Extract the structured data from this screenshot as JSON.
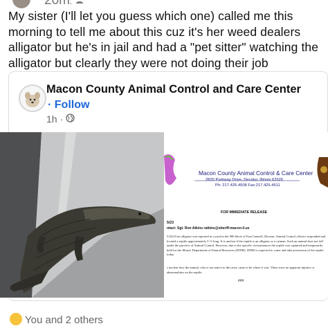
{
  "top_bar": {
    "time": "20m",
    "dot": "·",
    "audience_icon": "friends-icon"
  },
  "post": {
    "text": "My sister (I'll let you guess which one) called me this morning to tell me about this cuz it's her weed dealers alligator but he's in jail and had a \"pet sitter\" watching the alligator but clearly they were not doing their job"
  },
  "shared": {
    "org_name": "Macon County Animal Control and Care Center",
    "follow_label": "Follow",
    "follow_dot": "·",
    "time": "1h",
    "time_dot": "·",
    "audience_icon": "globe-icon"
  },
  "document": {
    "header": "Macon County Animal Control & Care Center",
    "address": "2820 Parkway Drive, Decatur, Illinois 62526",
    "phone": "Ph: 217.425.4508 Fax:217.425.4511",
    "release": "FOR IMMEDIATE RELEASE",
    "date": "5/23",
    "contact": "ntact: Sgt. Ron Atkins ratkins@sheriff-macon-il.us",
    "paragraph1": "5/24/23 an alligator was reported in a yard in the 900 block of East Cantrell, Decatur. Animal Control officers responded and located a reptile approximately 3 ½' long. It is unclear if the reptile is an alligator or a caiman. Such an animal does not fall under the purview of Animal Control. However, due to the specific circumstances the reptile was captured and temporarily held for the Illinois Department of Natural Resources (IDNR). IDNR is expected to come and take possession of the reptile today.",
    "paragraph2": "s unclear how the animal, who is not native to this area, came to be where it was. There were no apparent injuries or abnormalities on the reptile.",
    "end_mark": "###"
  },
  "reactions": {
    "text": "You and 2 others"
  },
  "colors": {
    "link_blue": "#1b66d8",
    "text": "#111111",
    "muted": "#666666"
  }
}
